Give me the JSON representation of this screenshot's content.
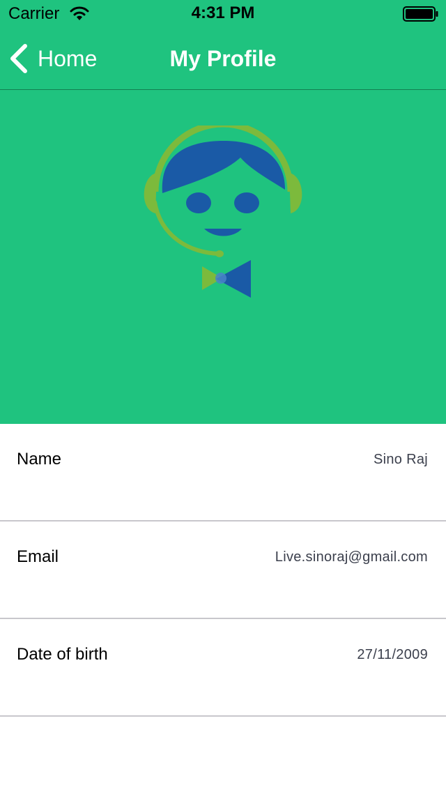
{
  "status_bar": {
    "carrier": "Carrier",
    "time": "4:31 PM"
  },
  "nav": {
    "back_label": "Home",
    "title": "My Profile"
  },
  "colors": {
    "header_background": "#1fc37f",
    "avatar_blue": "#1a5aa6",
    "avatar_green": "#7cba3c"
  },
  "profile": {
    "rows": [
      {
        "label": "Name",
        "value": "Sino Raj"
      },
      {
        "label": "Email",
        "value": "Live.sinoraj@gmail.com"
      },
      {
        "label": "Date of birth",
        "value": "27/11/2009"
      }
    ]
  }
}
